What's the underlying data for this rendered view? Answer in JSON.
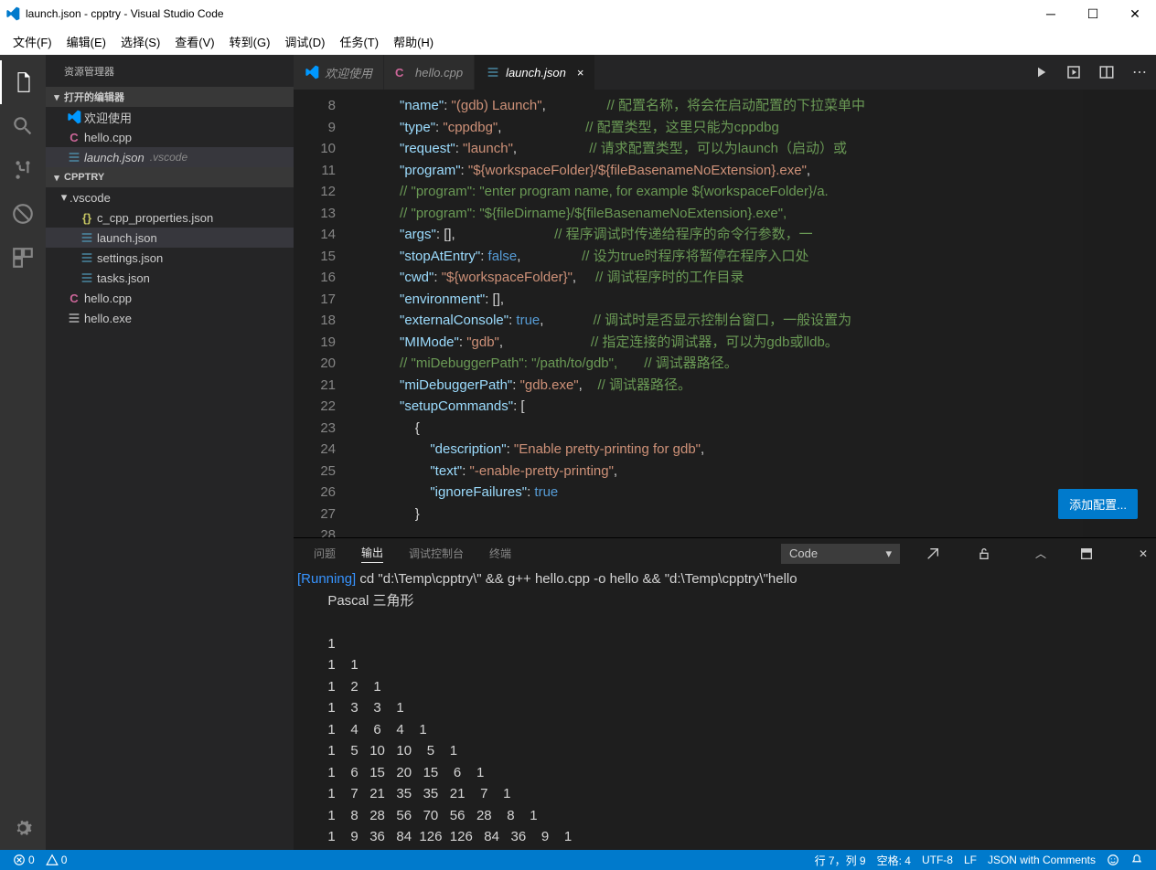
{
  "window": {
    "title": "launch.json - cpptry - Visual Studio Code"
  },
  "menu": [
    "文件(F)",
    "编辑(E)",
    "选择(S)",
    "查看(V)",
    "转到(G)",
    "调试(D)",
    "任务(T)",
    "帮助(H)"
  ],
  "sidebar": {
    "title": "资源管理器",
    "open_editors_header": "打开的编辑器",
    "open_editors": [
      {
        "label": "欢迎使用",
        "kind": "vs"
      },
      {
        "label": "hello.cpp",
        "kind": "cpp"
      },
      {
        "label": "launch.json",
        "kind": "json",
        "meta": ".vscode",
        "sel": true
      }
    ],
    "workspace_header": "CPPTRY",
    "folders": [
      {
        "label": ".vscode",
        "expanded": true,
        "children": [
          {
            "label": "c_cpp_properties.json",
            "kind": "json-obj"
          },
          {
            "label": "launch.json",
            "kind": "json",
            "sel": true
          },
          {
            "label": "settings.json",
            "kind": "json"
          },
          {
            "label": "tasks.json",
            "kind": "json"
          }
        ]
      }
    ],
    "root_files": [
      {
        "label": "hello.cpp",
        "kind": "cpp"
      },
      {
        "label": "hello.exe",
        "kind": "exe"
      }
    ]
  },
  "tabs": [
    {
      "label": "欢迎使用",
      "kind": "vs"
    },
    {
      "label": "hello.cpp",
      "kind": "cpp"
    },
    {
      "label": "launch.json",
      "kind": "json",
      "active": true
    }
  ],
  "editor": {
    "first_line": 8,
    "add_config_label": "添加配置...",
    "lines": [
      "",
      "            <k>\"name\"</k><p>: </p><s>\"(gdb) Launch\"</s><p>,</p>                <c>// 配置名称，将会在启动配置的下拉菜单中</c>",
      "            <k>\"type\"</k><p>: </p><s>\"cppdbg\"</s><p>,</p>                      <c>// 配置类型，这里只能为cppdbg</c>",
      "            <k>\"request\"</k><p>: </p><s>\"launch\"</s><p>,</p>                   <c>// 请求配置类型，可以为launch（启动）或</c>",
      "            <k>\"program\"</k><p>: </p><s>\"${workspaceFolder}/${fileBasenameNoExtension}.exe\"</s><p>,</p>",
      "            <c>// \"program\": \"enter program name, for example ${workspaceFolder}/a.</c>",
      "            <c>// \"program\": \"${fileDirname}/${fileBasenameNoExtension}.exe\",</c>",
      "            <k>\"args\"</k><p>: [],</p>                          <c>// 程序调试时传递给程序的命令行参数，一</c>",
      "            <k>\"stopAtEntry\"</k><p>: </p><w>false</w><p>,</p>                <c>// 设为true时程序将暂停在程序入口处</c>",
      "            <k>\"cwd\"</k><p>: </p><s>\"${workspaceFolder}\"</s><p>,</p>     <c>// 调试程序时的工作目录</c>",
      "            <k>\"environment\"</k><p>: [],</p>",
      "            <k>\"externalConsole\"</k><p>: </p><w>true</w><p>,</p>             <c>// 调试时是否显示控制台窗口，一般设置为</c>",
      "            <k>\"MIMode\"</k><p>: </p><s>\"gdb\"</s><p>,</p>                       <c>// 指定连接的调试器，可以为gdb或lldb。</c>",
      "            <c>// \"miDebuggerPath\": \"/path/to/gdb\",       // 调试器路径。</c>",
      "            <k>\"miDebuggerPath\"</k><p>: </p><s>\"gdb.exe\"</s><p>,</p>    <c>// 调试器路径。</c>",
      "            <k>\"setupCommands\"</k><p>: [</p>",
      "                <p>{</p>",
      "                    <k>\"description\"</k><p>: </p><s>\"Enable pretty-printing for gdb\"</s><p>,</p>",
      "                    <k>\"text\"</k><p>: </p><s>\"-enable-pretty-printing\"</s><p>,</p>",
      "                    <k>\"ignoreFailures\"</k><p>: </p><w>true</w>",
      "                <p>}</p>"
    ]
  },
  "panel": {
    "tabs": [
      "问题",
      "输出",
      "调试控制台",
      "终端"
    ],
    "active_tab": "输出",
    "select_value": "Code",
    "output": {
      "run_prefix": "[Running]",
      "cmd": " cd \"d:\\Temp\\cpptry\\\" && g++ hello.cpp -o hello && \"d:\\Temp\\cpptry\\\"hello",
      "title": "        Pascal 三角形",
      "rows": [
        [
          1
        ],
        [
          1,
          1
        ],
        [
          1,
          2,
          1
        ],
        [
          1,
          3,
          3,
          1
        ],
        [
          1,
          4,
          6,
          4,
          1
        ],
        [
          1,
          5,
          10,
          10,
          5,
          1
        ],
        [
          1,
          6,
          15,
          20,
          15,
          6,
          1
        ],
        [
          1,
          7,
          21,
          35,
          35,
          21,
          7,
          1
        ],
        [
          1,
          8,
          28,
          56,
          70,
          56,
          28,
          8,
          1
        ],
        [
          1,
          9,
          36,
          84,
          126,
          126,
          84,
          36,
          9,
          1
        ]
      ]
    }
  },
  "status": {
    "errors": "0",
    "warnings": "0",
    "ln": "行 7，列 9",
    "spaces": "空格: 4",
    "enc": "UTF-8",
    "eol": "LF",
    "lang": "JSON with Comments"
  }
}
